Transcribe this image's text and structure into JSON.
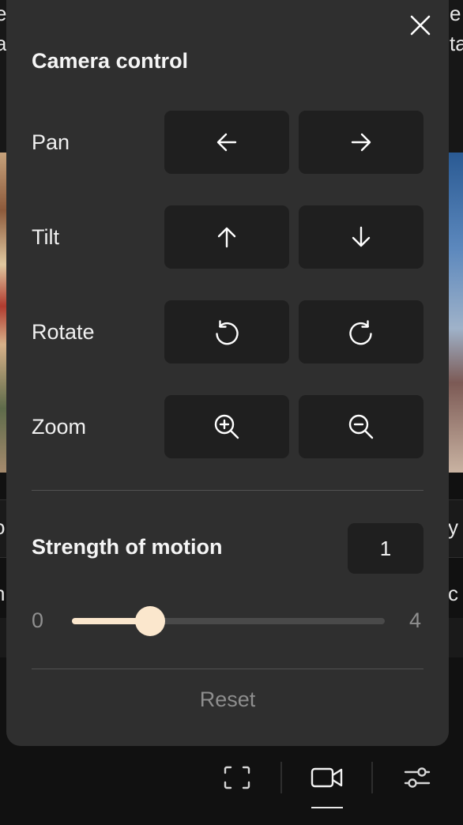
{
  "background": {
    "left_fragments": [
      "e",
      "a"
    ],
    "right_fragments": [
      "e",
      "ta"
    ],
    "row_left_1": "o",
    "row_right_1": "y",
    "row_left_2": "n",
    "row_right_2": "c"
  },
  "panel": {
    "title": "Camera control",
    "close_icon": "close-icon",
    "controls": [
      {
        "label": "Pan",
        "buttons": [
          {
            "icon": "arrow-left-icon"
          },
          {
            "icon": "arrow-right-icon"
          }
        ]
      },
      {
        "label": "Tilt",
        "buttons": [
          {
            "icon": "arrow-up-icon"
          },
          {
            "icon": "arrow-down-icon"
          }
        ]
      },
      {
        "label": "Rotate",
        "buttons": [
          {
            "icon": "rotate-ccw-icon"
          },
          {
            "icon": "rotate-cw-icon"
          }
        ]
      },
      {
        "label": "Zoom",
        "buttons": [
          {
            "icon": "zoom-in-icon"
          },
          {
            "icon": "zoom-out-icon"
          }
        ]
      }
    ],
    "strength": {
      "label": "Strength of motion",
      "value": "1",
      "min": "0",
      "max": "4",
      "fraction": 0.25
    },
    "reset_label": "Reset"
  },
  "toolbar": {
    "items": [
      {
        "icon": "fullscreen-icon"
      },
      {
        "icon": "video-camera-icon",
        "active": true
      },
      {
        "icon": "sliders-icon"
      }
    ]
  },
  "colors": {
    "panel_bg": "#2f2f2f",
    "button_bg": "#1f1f1f",
    "accent": "#fbe7cd"
  }
}
